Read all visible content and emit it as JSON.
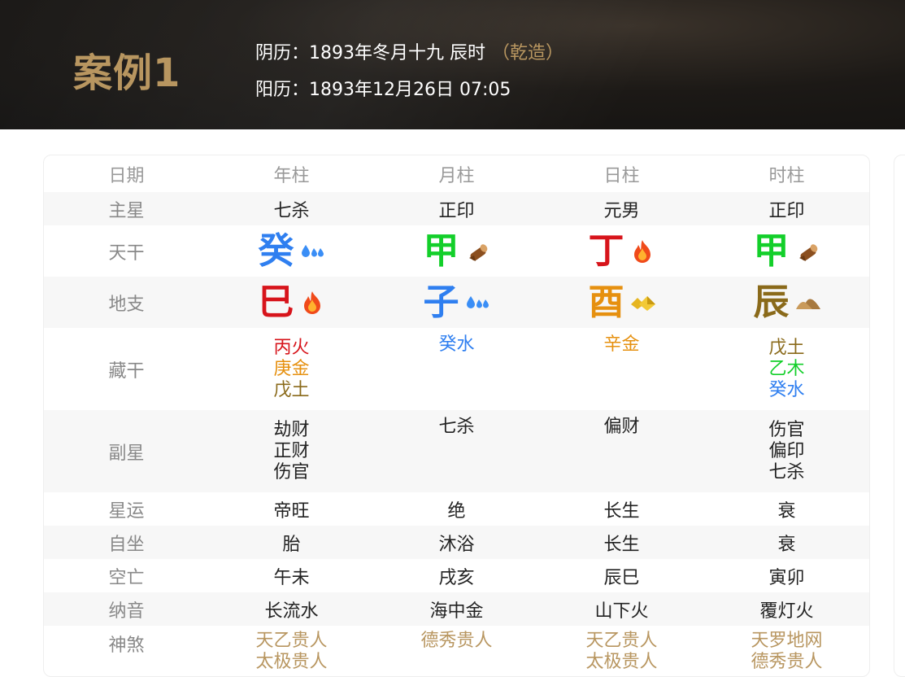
{
  "header": {
    "case_title": "案例1",
    "lunar": "阴历：1893年冬月十九 辰时",
    "gender": "（乾造）",
    "solar": "阳历：1893年12月26日 07:05"
  },
  "table": {
    "labels": {
      "date": "日期",
      "main_star": "主星",
      "tiangan": "天干",
      "dizhi": "地支",
      "canggan": "藏干",
      "sub_star": "副星",
      "xingyun": "星运",
      "zizuo": "自坐",
      "kongwang": "空亡",
      "nayin": "纳音",
      "shensha": "神煞"
    },
    "columns": [
      {
        "title": "年柱",
        "main_star": "七杀",
        "tiangan": "癸",
        "tiangan_icon": "water-icon",
        "dizhi": "巳",
        "dizhi_icon": "fire-icon",
        "canggan": [
          "丙火",
          "庚金",
          "戊土"
        ],
        "sub_star": [
          "劫财",
          "正财",
          "伤官"
        ],
        "xingyun": "帝旺",
        "zizuo": "胎",
        "kongwang": "午未",
        "nayin": "长流水",
        "shensha": [
          "天乙贵人",
          "太极贵人"
        ]
      },
      {
        "title": "月柱",
        "main_star": "正印",
        "tiangan": "甲",
        "tiangan_icon": "wood-icon",
        "dizhi": "子",
        "dizhi_icon": "water-icon",
        "canggan": [
          "癸水"
        ],
        "sub_star": [
          "七杀"
        ],
        "xingyun": "绝",
        "zizuo": "沐浴",
        "kongwang": "戌亥",
        "nayin": "海中金",
        "shensha": [
          "德秀贵人"
        ]
      },
      {
        "title": "日柱",
        "main_star": "元男",
        "tiangan": "丁",
        "tiangan_icon": "fire-icon",
        "dizhi": "酉",
        "dizhi_icon": "metal-icon",
        "canggan": [
          "辛金"
        ],
        "sub_star": [
          "偏财"
        ],
        "xingyun": "长生",
        "zizuo": "长生",
        "kongwang": "辰巳",
        "nayin": "山下火",
        "shensha": [
          "天乙贵人",
          "太极贵人"
        ]
      },
      {
        "title": "时柱",
        "main_star": "正印",
        "tiangan": "甲",
        "tiangan_icon": "wood-icon",
        "dizhi": "辰",
        "dizhi_icon": "earth-icon",
        "canggan": [
          "戊土",
          "乙木",
          "癸水"
        ],
        "sub_star": [
          "伤官",
          "偏印",
          "七杀"
        ],
        "xingyun": "衰",
        "zizuo": "衰",
        "kongwang": "寅卯",
        "nayin": "覆灯火",
        "shensha": [
          "天罗地网",
          "德秀贵人"
        ]
      }
    ]
  },
  "colors": {
    "water": "#2f7ff0",
    "wood": "#13cf2a",
    "fire": "#d7141b",
    "metal": "#e6900f",
    "earth": "#8a6a1a",
    "gold": "#b89660"
  }
}
